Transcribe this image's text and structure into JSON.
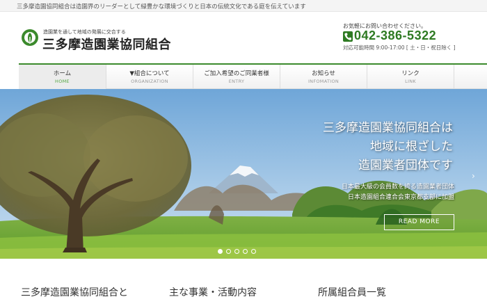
{
  "topbar": {
    "text": "三多摩造園協同組合は造園界のリーダーとして緑豊かな環境づくりと日本の伝統文化である庭を伝えています"
  },
  "header": {
    "logo_tagline": "造園業を通して地域の発展に交合する",
    "logo_name": "三多摩造園業協同組合",
    "contact_lead": "お気軽にお問い合わせください。",
    "phone": "042-386-5322",
    "hours": "対応可能時間 9:00-17:00 [ 土・日・祝日除く ]"
  },
  "nav": [
    {
      "label": "ホーム",
      "sub": "HOME",
      "active": true
    },
    {
      "label": "▼組合について",
      "sub": "ORGANIZATION"
    },
    {
      "label": "ご加入希望のご同業者様",
      "sub": "ENTRY"
    },
    {
      "label": "お知らせ",
      "sub": "INFOMATION"
    },
    {
      "label": "リンク",
      "sub": "LINK"
    }
  ],
  "hero": {
    "title_lines": [
      "三多摩造園業協同組合は",
      "地域に根ざした",
      "造園業者団体です"
    ],
    "sub_lines": [
      "日本最大級の会員数を誇る造園業者団体",
      "日本造園組合連合会東京都支部に加盟"
    ],
    "button": "READ MORE",
    "arrow": "›",
    "slide_count": 5,
    "active_slide": 1
  },
  "sections": [
    "三多摩造園業協同組合と",
    "主な事業・活動内容",
    "所属組合員一覧"
  ],
  "colors": {
    "brand_green": "#2e7a22",
    "nav_accent": "#3b8a2c"
  }
}
